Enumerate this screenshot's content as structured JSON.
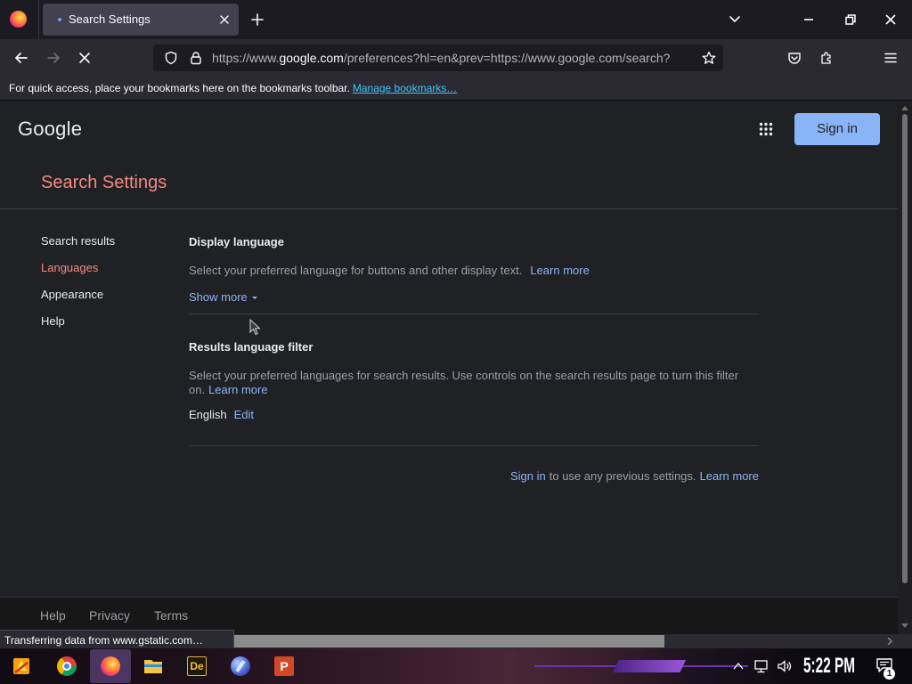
{
  "browser": {
    "tab_title": "Search Settings",
    "url": {
      "scheme": "https://www.",
      "domain": "google.com",
      "rest": "/preferences?hl=en&prev=https://www.google.com/search?"
    },
    "bookmarks_bar": {
      "message": "For quick access, place your bookmarks here on the bookmarks toolbar.",
      "link": "Manage bookmarks…"
    },
    "status_text": "Transferring data from www.gstatic.com…"
  },
  "header": {
    "logo": "Google",
    "sign_in": "Sign in"
  },
  "settings": {
    "title": "Search Settings",
    "nav": [
      {
        "label": "Search results",
        "active": false
      },
      {
        "label": "Languages",
        "active": true
      },
      {
        "label": "Appearance",
        "active": false
      },
      {
        "label": "Help",
        "active": false
      }
    ],
    "display_language": {
      "heading": "Display language",
      "description": "Select your preferred language for buttons and other display text.",
      "learn_more": "Learn more",
      "show_more": "Show more"
    },
    "results_filter": {
      "heading": "Results language filter",
      "description": "Select your preferred languages for search results. Use controls on the search results page to turn this filter on.",
      "learn_more": "Learn more",
      "language": "English",
      "edit": "Edit"
    },
    "sign_in_note": {
      "link": "Sign in",
      "text": "to use any previous settings.",
      "learn_more": "Learn more"
    }
  },
  "footer": {
    "links": [
      "Help",
      "Privacy",
      "Terms"
    ]
  },
  "taskbar": {
    "pinned_icons": [
      "start-icon",
      "chrome-icon",
      "firefox-icon",
      "file-explorer-icon",
      "de-app-icon",
      "globe-app-icon",
      "powerpoint-icon"
    ],
    "active_app": "firefox-icon",
    "de_label": "De",
    "powerpoint_label": "P",
    "clock": "5:22 PM",
    "notification_count": "1"
  },
  "colors": {
    "accent": "#8ab4f8",
    "heading": "#f28b82",
    "page_bg": "#202124",
    "text": "#e8eaed",
    "muted": "#9aa0a6"
  }
}
